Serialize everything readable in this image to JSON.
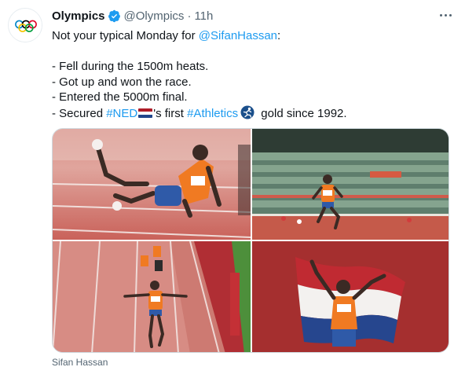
{
  "author": {
    "name": "Olympics",
    "handle": "@Olympics",
    "separator": "·",
    "time": "11h",
    "avatar_icon": "olympic-rings-icon",
    "verified_icon": "verified-badge-icon"
  },
  "tweet": {
    "line1_text": "Not your typical Monday for ",
    "line1_mention": "@SifanHassan",
    "line1_end": ":",
    "bullet1": "- Fell during the 1500m heats.",
    "bullet2": "- Got up and won the race.",
    "bullet3": "- Entered the 5000m final.",
    "bullet4_start": "- Secured ",
    "hashtag_ned": "#NED",
    "bullet4_mid": "'s first ",
    "hashtag_athletics": "#Athletics",
    "bullet4_end": " gold since 1992."
  },
  "media": {
    "tile1_alt": "runner-fallen-on-track-photo",
    "tile2_alt": "runner-in-stadium-photo",
    "tile3_alt": "runner-crossing-finish-photo",
    "tile4_alt": "runner-with-dutch-flag-photo"
  },
  "caption": "Sifan Hassan",
  "colors": {
    "link": "#1d9bf0",
    "secondary_text": "#536471",
    "flag_red": "#ae1c28",
    "flag_white": "#ffffff",
    "flag_blue": "#21468b",
    "kit_orange": "#f07a22"
  }
}
